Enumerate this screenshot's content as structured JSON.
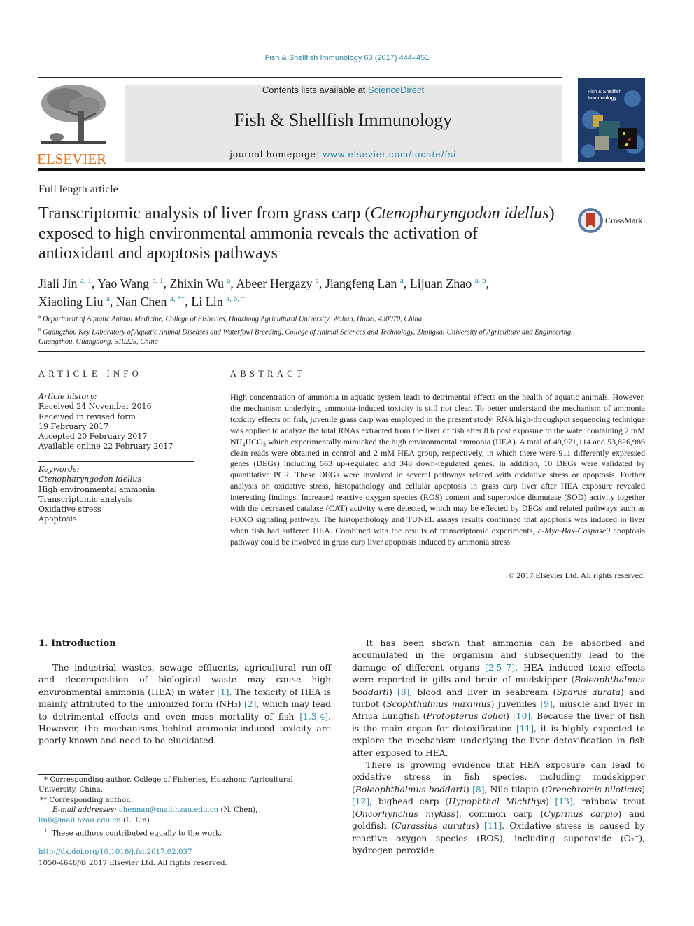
{
  "header": {
    "citation": "Fish & Shellfish Immunology 63 (2017) 444–451",
    "contents_prefix": "Contents lists available at ",
    "contents_link": "ScienceDirect",
    "journal_name": "Fish & Shellfish Immunology",
    "homepage_prefix": "journal homepage: ",
    "homepage_link": "www.elsevier.com/locate/fsi",
    "publisher_logo": "ELSEVIER",
    "cover_title_1": "Fish & Shellfish",
    "cover_title_2": "Immunology",
    "accent_color": "#2a86a9",
    "publisher_color": "#e9711c"
  },
  "article": {
    "type": "Full length article",
    "title_part1": "Transcriptomic analysis of liver from grass carp (",
    "title_species": "Ctenopharyngodon idellus",
    "title_part2": ") exposed to high environmental ammonia reveals the activation of antioxidant and apoptosis pathways",
    "crossmark_label": "CrossMark",
    "authors": [
      {
        "name": "Jiali Jin",
        "sup": "a, 1"
      },
      {
        "name": "Yao Wang",
        "sup": "a, 1"
      },
      {
        "name": "Zhixin Wu",
        "sup": "a"
      },
      {
        "name": "Abeer Hergazy",
        "sup": "a"
      },
      {
        "name": "Jiangfeng Lan",
        "sup": "a"
      },
      {
        "name": "Lijuan Zhao",
        "sup": "a, b"
      },
      {
        "name": "Xiaoling Liu",
        "sup": "a"
      },
      {
        "name": "Nan Chen",
        "sup": "a, **"
      },
      {
        "name": "Li Lin",
        "sup": "a, b, *"
      }
    ],
    "affiliations": [
      {
        "mark": "a",
        "text": "Department of Aquatic Animal Medicine, College of Fisheries, Huazhong Agricultural University, Wuhan, Hubei, 430070, China"
      },
      {
        "mark": "b",
        "text": "Guangzhou Key Laboratory of Aquatic Animal Diseases and Waterfowl Breeding, College of Animal Sciences and Technology, Zhongkai University of Agriculture and Engineering, Guangzhou, Guangdong, 510225, China"
      }
    ]
  },
  "article_info": {
    "heading": "ARTICLE INFO",
    "history_label": "Article history:",
    "history": [
      "Received 24 November 2016",
      "Received in revised form",
      "19 February 2017",
      "Accepted 20 February 2017",
      "Available online 22 February 2017"
    ],
    "keywords_label": "Keywords:",
    "keywords": [
      "Ctenopharyngodon idellus",
      "High environmental ammonia",
      "Transcriptomic analysis",
      "Oxidative stress",
      "Apoptosis"
    ]
  },
  "abstract": {
    "heading": "ABSTRACT",
    "text_1": "High concentration of ammonia in aquatic system leads to detrimental effects on the health of aquatic animals. However, the mechanism underlying ammonia-induced toxicity is still not clear. To better understand the mechanism of ammonia toxicity effects on fish, juvenile grass carp was employed in the present study. RNA high-throughput sequencing technique was applied to analyze the total RNAs extracted from the liver of fish after 8 h post exposure to the water containing 2 mM NH₄HCO₃ which experimentally mimicked the high environmental ammonia (HEA). A total of 49,971,114 and 53,826,986 clean reads were obtained in control and 2 mM HEA group, respectively, in which there were 911 differently expressed genes (DEGs) including 563 up-regulated and 348 down-regulated genes. In addition, 10 DEGs were validated by quantitative PCR. These DEGs were involved in several pathways related with oxidative stress or apoptosis. Further analysis on oxidative stress, histopathology and cellular apoptosis in grass carp liver after HEA exposure revealed interesting findings. Increased reactive oxygen species (ROS) content and superoxide dismutase (SOD) activity together with the decreased catalase (CAT) activity were detected, which may be effected by DEGs and related pathways such as FOXO signaling pathway. The histopathology and TUNEL assays results confirmed that apoptosis was induced in liver when fish had suffered HEA. Combined with the results of transcriptomic experiments, ",
    "text_italic": "c-Myc-Bax-Caspase9",
    "text_2": " apoptosis pathway could be involved in grass carp liver apoptosis induced by ammonia stress.",
    "copyright": "© 2017 Elsevier Ltd. All rights reserved."
  },
  "intro": {
    "heading": "1.  Introduction",
    "p1_a": "The industrial wastes, sewage effluents, agricultural run-off and decomposition of biological waste may cause high environmental ammonia (HEA) in water ",
    "p1_ref1": "[1]",
    "p1_b": ". The toxicity of HEA is mainly attributed to the unionized form (NH₃) ",
    "p1_ref2": "[2]",
    "p1_c": ", which may lead to detrimental effects and even mass mortality of fish ",
    "p1_ref3": "[1,3,4]",
    "p1_d": ". However, the mechanisms behind ammonia-induced toxicity are poorly known and need to be elucidated.",
    "p2_a": "It has been shown that ammonia can be absorbed and accumulated in the organism and subsequently lead to the damage of different organs ",
    "p2_ref1": "[2,5–7]",
    "p2_b": ". HEA induced toxic effects were reported in gills and brain of mudskipper (",
    "p2_sp1": "Boleophthalmus boddarti",
    "p2_c": ") ",
    "p2_ref2": "[8]",
    "p2_d": ", blood and liver in seabream (",
    "p2_sp2": "Sparus aurata",
    "p2_e": ") and turbot (",
    "p2_sp3": "Scophthalmus maximus",
    "p2_f": ") juveniles ",
    "p2_ref3": "[9]",
    "p2_g": ", muscle and liver in Africa Lungfish (",
    "p2_sp4": "Protopterus dolloi",
    "p2_h": ") ",
    "p2_ref4": "[10]",
    "p2_i": ". Because the liver of fish is the main organ for detoxification ",
    "p2_ref5": "[11]",
    "p2_j": ", it is highly expected to explore the mechanism underlying the liver detoxification in fish after exposed to HEA.",
    "p3_a": "There is growing evidence that HEA exposure can lead to oxidative stress in fish species, including mudskipper (",
    "p3_sp1": "Boleophthalmus boddarti",
    "p3_b": ") ",
    "p3_ref1": "[8]",
    "p3_c": ", Nile tilapia (",
    "p3_sp2": "Oreochromis niloticus",
    "p3_d": ") ",
    "p3_ref2": "[12]",
    "p3_e": ", bighead carp (",
    "p3_sp3": "Hypophthal Michthys",
    "p3_f": ") ",
    "p3_ref3": "[13]",
    "p3_g": ", rainbow trout (",
    "p3_sp4": "Oncorhynchus mykiss",
    "p3_h": "), common carp (",
    "p3_sp5": "Cyprinus carpio",
    "p3_i": ") and goldfish (",
    "p3_sp6": "Carassius auratus",
    "p3_j": ") ",
    "p3_ref4": "[11]",
    "p3_k": ". Oxidative stress is caused by reactive oxygen species (ROS), including superoxide (O₂⁻), hydrogen peroxide"
  },
  "footnotes": {
    "fn1": "* Corresponding author. College of Fisheries, Huazhong Agricultural University, China.",
    "fn2": "** Corresponding author.",
    "email_label": "E-mail addresses: ",
    "email1": "chennan@mail.hzau.edu.cn",
    "email1_name": " (N. Chen), ",
    "email2": "linli@mail.hzau.edu.cn",
    "email2_name": " (L. Lin).",
    "fn3": "These authors contributed equally to the work.",
    "fn3_mark": "1",
    "doi": "http://dx.doi.org/10.1016/j.fsi.2017.02.037",
    "issn": "1050-4648/© 2017 Elsevier Ltd. All rights reserved."
  }
}
